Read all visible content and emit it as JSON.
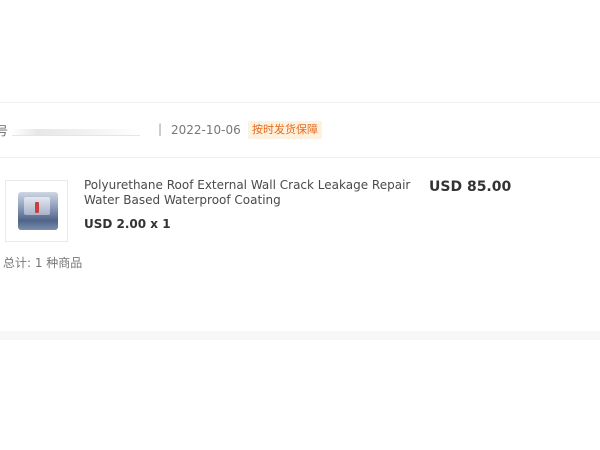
{
  "order": {
    "order_no_label": "号",
    "separator": "|",
    "date": "2022-10-06",
    "badge": "按时发货保障"
  },
  "product": {
    "title": "Polyurethane Roof External Wall Crack Leakage Repair Water Based Waterproof Coating",
    "unit_price_qty": "USD 2.00 x 1",
    "total": "USD 85.00"
  },
  "summary": {
    "text": "总计: 1 种商品"
  },
  "colors": {
    "badge_text": "#e36c1c",
    "badge_bg": "#fff1e0",
    "divider": "#efefef",
    "bottom_band": "#f7f7f7"
  }
}
